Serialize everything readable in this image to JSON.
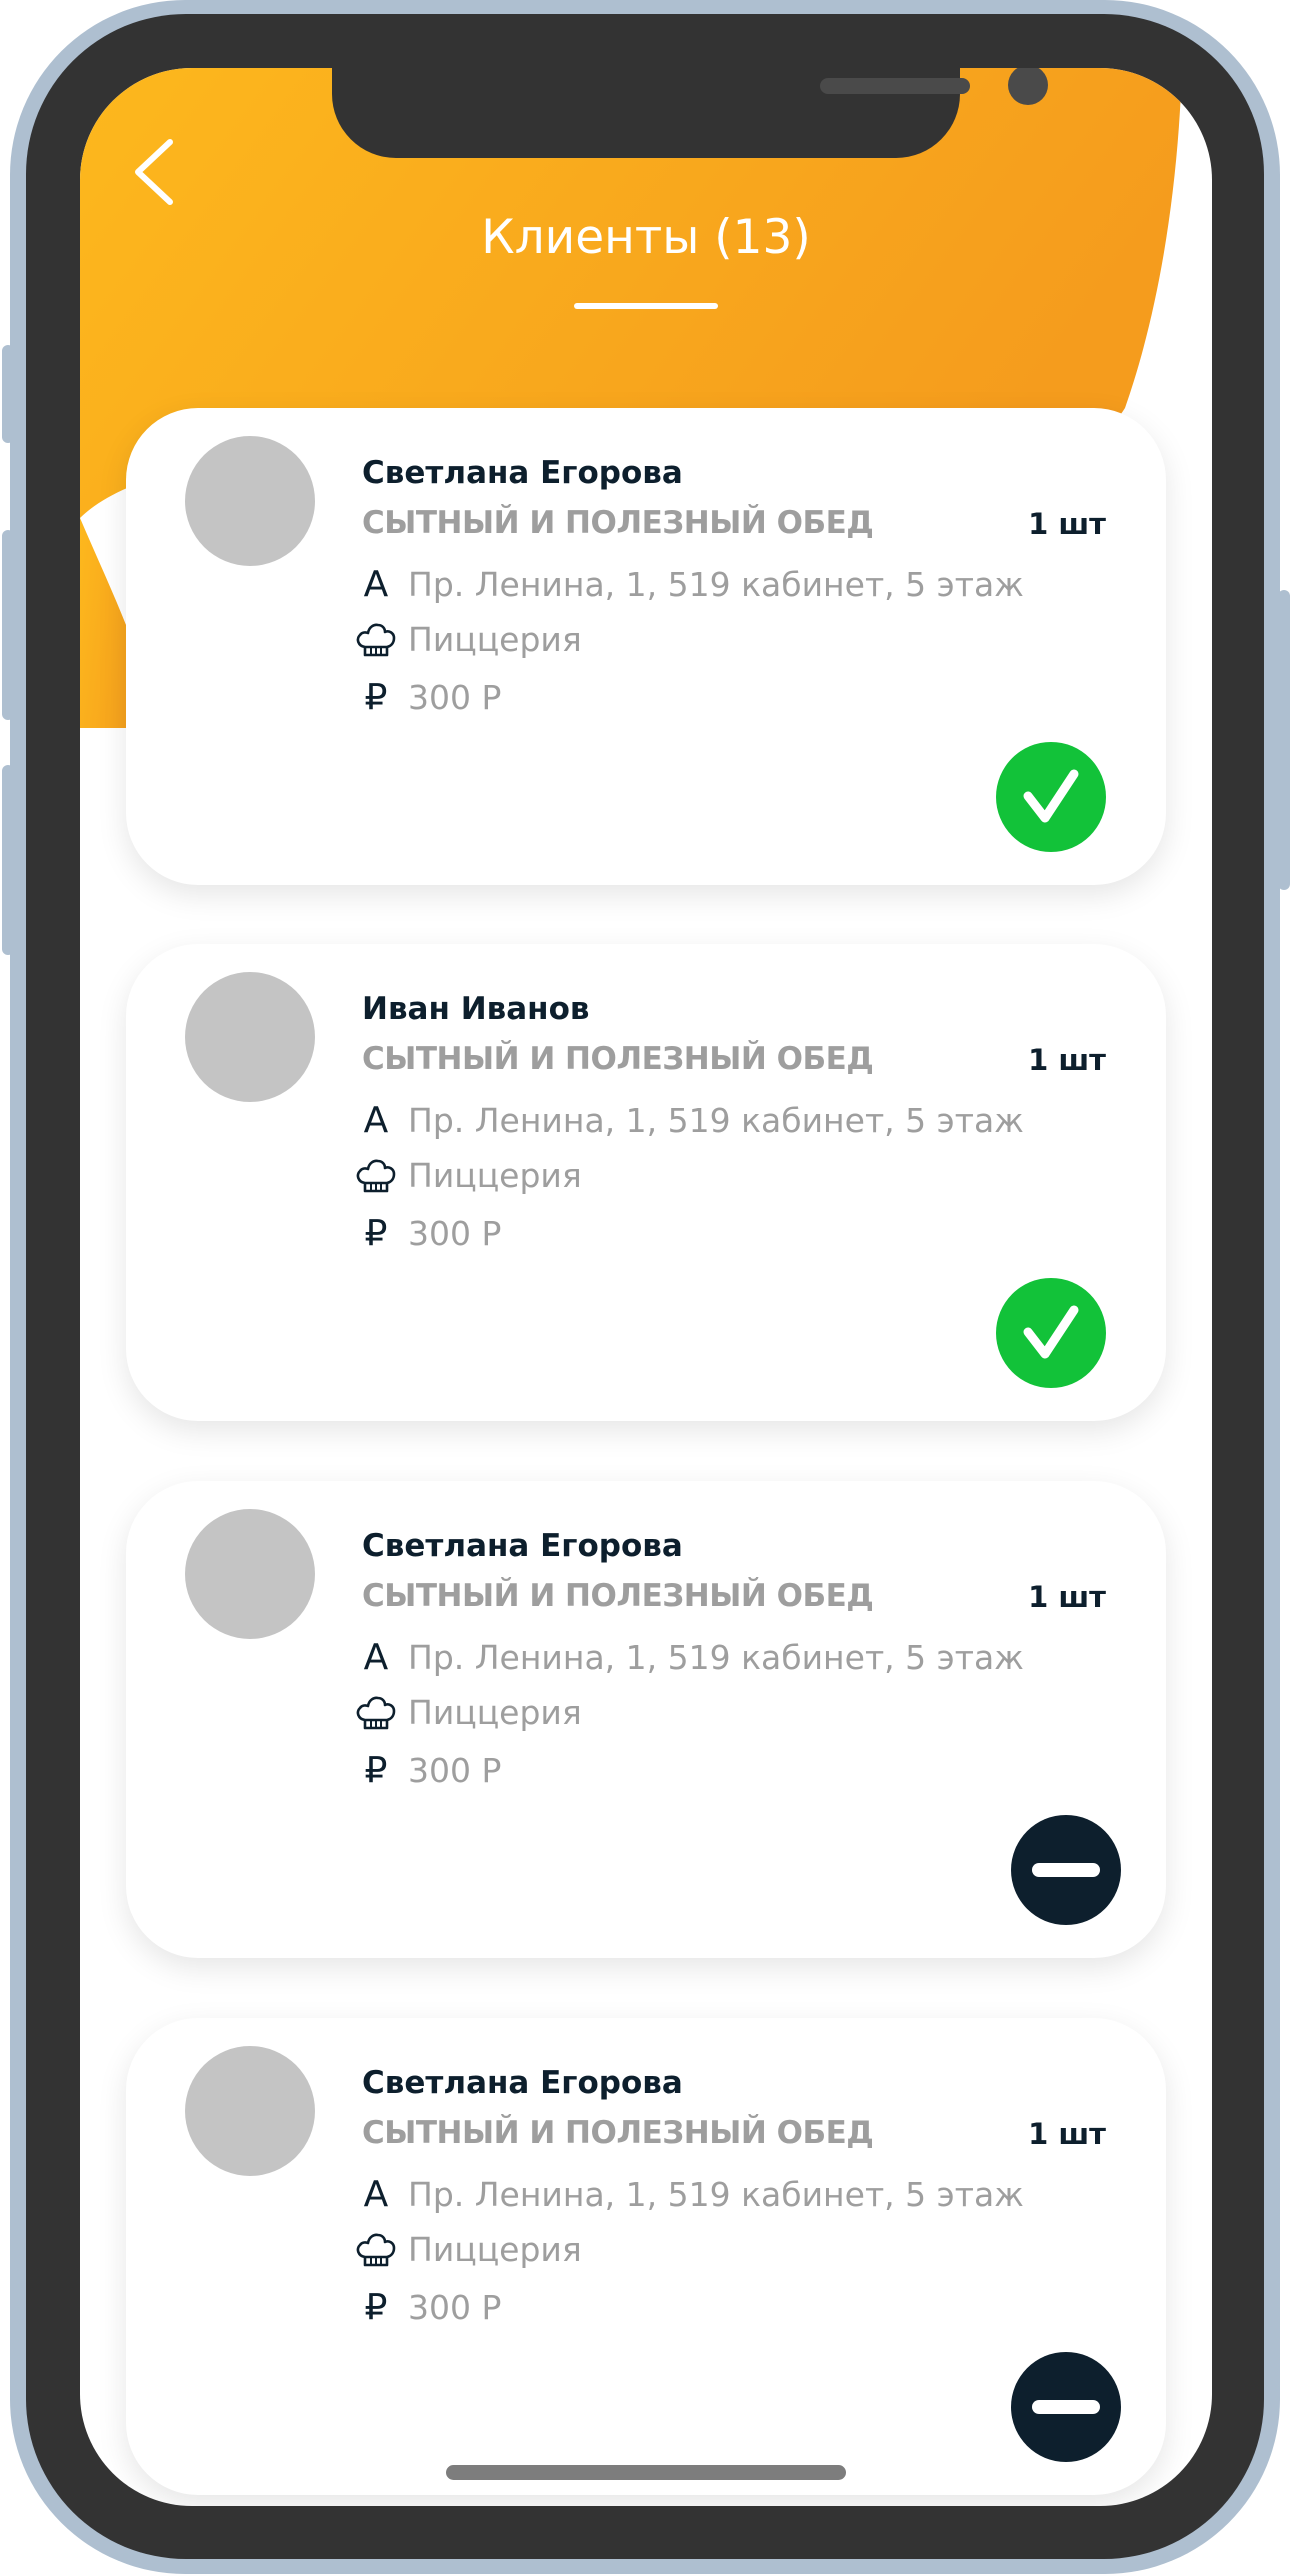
{
  "header": {
    "title": "Клиенты (13)",
    "back_icon": "chevron-left-icon"
  },
  "colors": {
    "accent_orange": "#f9a11b",
    "done_green": "#12c239",
    "pending_dark": "#0d1f2d",
    "muted_text": "#9e9e9e",
    "avatar_placeholder": "#c4c4c4"
  },
  "clients": [
    {
      "name": "Светлана Егорова",
      "meal": "СЫТНЫЙ И ПОЛЕЗНЫЙ ОБЕД",
      "quantity": "1 шт",
      "address_icon": "А",
      "address": "Пр. Ленина, 1, 519 кабинет, 5 этаж",
      "restaurant": "Пиццерия",
      "currency_icon": "₽",
      "price": "300 Р",
      "status": "done",
      "status_icon": "checkmark-icon"
    },
    {
      "name": "Иван Иванов",
      "meal": "СЫТНЫЙ И ПОЛЕЗНЫЙ ОБЕД",
      "quantity": "1 шт",
      "address_icon": "А",
      "address": "Пр. Ленина, 1, 519 кабинет, 5 этаж",
      "restaurant": "Пиццерия",
      "currency_icon": "₽",
      "price": "300 Р",
      "status": "done",
      "status_icon": "checkmark-icon"
    },
    {
      "name": "Светлана Егорова",
      "meal": "СЫТНЫЙ И ПОЛЕЗНЫЙ ОБЕД",
      "quantity": "1 шт",
      "address_icon": "А",
      "address": "Пр. Ленина, 1, 519 кабинет, 5 этаж",
      "restaurant": "Пиццерия",
      "currency_icon": "₽",
      "price": "300 Р",
      "status": "pending",
      "status_icon": "minus-icon"
    },
    {
      "name": "Светлана Егорова",
      "meal": "СЫТНЫЙ И ПОЛЕЗНЫЙ ОБЕД",
      "quantity": "1 шт",
      "address_icon": "А",
      "address": "Пр. Ленина, 1, 519 кабинет, 5 этаж",
      "restaurant": "Пиццерия",
      "currency_icon": "₽",
      "price": "300 Р",
      "status": "pending",
      "status_icon": "minus-icon"
    }
  ]
}
